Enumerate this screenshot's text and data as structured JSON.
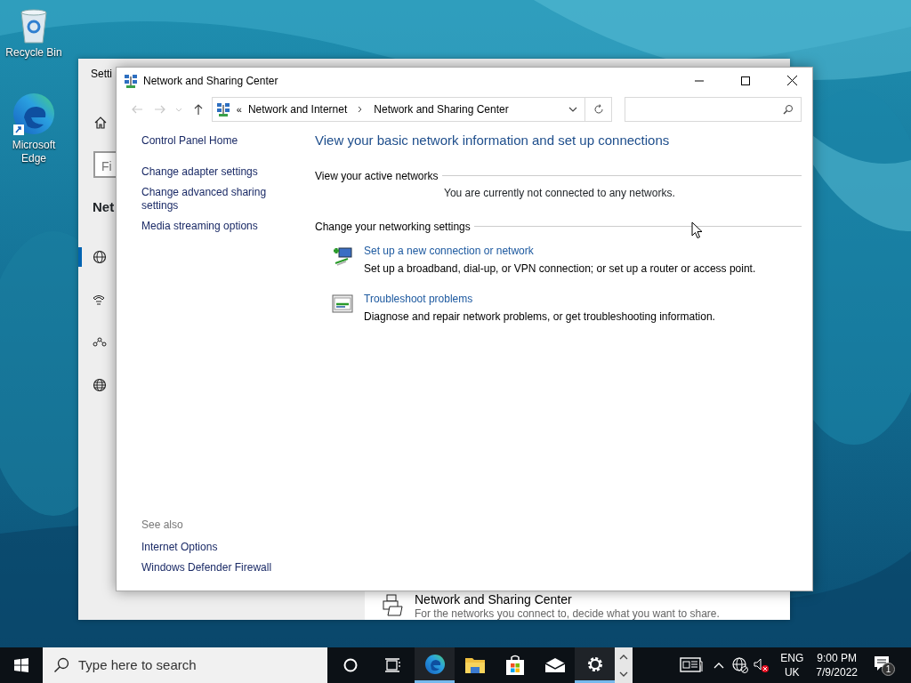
{
  "desktop_icons": [
    {
      "kind": "recycle",
      "label": "Recycle Bin"
    },
    {
      "kind": "edge",
      "label": "Microsoft Edge"
    }
  ],
  "settings_window": {
    "title": "Setti",
    "search_placeholder": "Fi",
    "heading": "Net",
    "nav_items": [
      {
        "kind": "network",
        "selected": true
      },
      {
        "kind": "dialup",
        "selected": false
      },
      {
        "kind": "vpn",
        "selected": false
      },
      {
        "kind": "globe",
        "selected": false
      }
    ],
    "page_item": {
      "title": "Network and Sharing Center",
      "description": "For the networks you connect to, decide what you want to share."
    }
  },
  "window": {
    "title": "Network and Sharing Center",
    "nav_buttons": [
      {
        "kind": "back",
        "disabled": true
      },
      {
        "kind": "forward",
        "disabled": true
      },
      {
        "kind": "recent",
        "disabled": true
      },
      {
        "kind": "up",
        "disabled": false
      }
    ],
    "breadcrumb": {
      "overflow": "«",
      "items": [
        "Network and Internet",
        "Network and Sharing Center"
      ]
    },
    "sidebar": {
      "links": [
        "Control Panel Home",
        "Change adapter settings",
        "Change advanced sharing settings",
        "Media streaming options"
      ],
      "see_also_label": "See also",
      "see_also": [
        "Internet Options",
        "Windows Defender Firewall"
      ]
    },
    "heading": "View your basic network information and set up connections",
    "active_networks": {
      "label": "View your active networks",
      "message": "You are currently not connected to any networks."
    },
    "settings_section": {
      "label": "Change your networking settings",
      "tasks": [
        {
          "kind": "new-connection",
          "title": "Set up a new connection or network",
          "description": "Set up a broadband, dial-up, or VPN connection; or set up a router or access point."
        },
        {
          "kind": "troubleshoot",
          "title": "Troubleshoot problems",
          "description": "Diagnose and repair network problems, or get troubleshooting information."
        }
      ]
    }
  },
  "taskbar": {
    "search_placeholder": "Type here to search",
    "apps": [
      {
        "kind": "cortana",
        "open": false
      },
      {
        "kind": "taskview",
        "open": false
      },
      {
        "kind": "edge",
        "open": true
      },
      {
        "kind": "explorer",
        "open": false
      },
      {
        "kind": "store",
        "open": false
      },
      {
        "kind": "mail",
        "open": false
      },
      {
        "kind": "settings",
        "open": true
      }
    ],
    "language": [
      "ENG",
      "UK"
    ],
    "time": "9:00 PM",
    "date": "7/9/2022",
    "notification_count": "1"
  }
}
